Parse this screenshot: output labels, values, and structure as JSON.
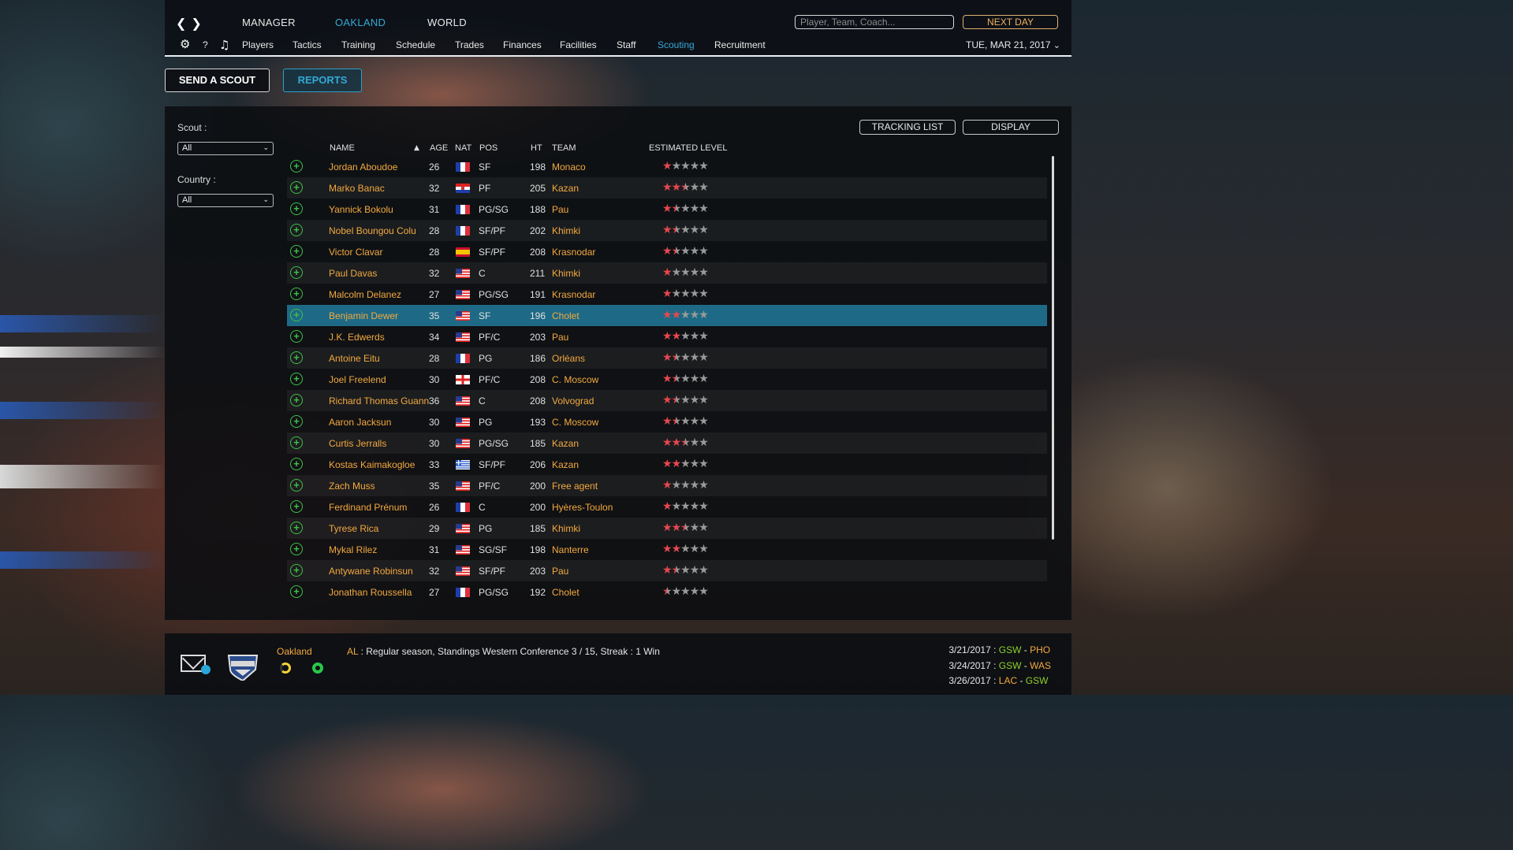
{
  "nav": {
    "tabs": [
      {
        "label": "MANAGER"
      },
      {
        "label": "OAKLAND"
      },
      {
        "label": "WORLD"
      }
    ],
    "search_placeholder": "Player, Team, Coach...",
    "next_day": "NEXT DAY",
    "sub_items": [
      "Players",
      "Tactics",
      "Training",
      "Schedule",
      "Trades",
      "Finances",
      "Facilities",
      "Staff",
      "Scouting",
      "Recruitment"
    ],
    "help": "?",
    "date": "TUE, MAR 21, 2017"
  },
  "actions": {
    "send_scout": "SEND A SCOUT",
    "reports": "REPORTS"
  },
  "filters": {
    "scout_label": "Scout :",
    "scout_value": "All",
    "country_label": "Country :",
    "country_value": "All"
  },
  "panel_buttons": {
    "tracking": "TRACKING LIST",
    "display": "DISPLAY"
  },
  "columns": {
    "name": "NAME",
    "age": "AGE",
    "nat": "NAT",
    "pos": "POS",
    "ht": "HT",
    "team": "TEAM",
    "level": "ESTIMATED LEVEL"
  },
  "players": [
    {
      "name": "Jordan Aboudoe",
      "age": "26",
      "nat": "FR",
      "pos": "SF",
      "ht": "198",
      "team": "Monaco",
      "stars": 1.0
    },
    {
      "name": "Marko Banac",
      "age": "32",
      "nat": "HR",
      "pos": "PF",
      "ht": "205",
      "team": "Kazan",
      "stars": 2.5
    },
    {
      "name": "Yannick Bokolu",
      "age": "31",
      "nat": "FR",
      "pos": "PG/SG",
      "ht": "188",
      "team": "Pau",
      "stars": 1.5
    },
    {
      "name": "Nobel Boungou Colu",
      "age": "28",
      "nat": "FR",
      "pos": "SF/PF",
      "ht": "202",
      "team": "Khimki",
      "stars": 1.5
    },
    {
      "name": "Victor Clavar",
      "age": "28",
      "nat": "ES",
      "pos": "SF/PF",
      "ht": "208",
      "team": "Krasnodar",
      "stars": 1.5
    },
    {
      "name": "Paul Davas",
      "age": "32",
      "nat": "US",
      "pos": "C",
      "ht": "211",
      "team": "Khimki",
      "stars": 1.0
    },
    {
      "name": "Malcolm Delanez",
      "age": "27",
      "nat": "US",
      "pos": "PG/SG",
      "ht": "191",
      "team": "Krasnodar",
      "stars": 1.0
    },
    {
      "name": "Benjamin Dewer",
      "age": "35",
      "nat": "US",
      "pos": "SF",
      "ht": "196",
      "team": "Cholet",
      "stars": 2.0
    },
    {
      "name": "J.K. Edwerds",
      "age": "34",
      "nat": "US",
      "pos": "PF/C",
      "ht": "203",
      "team": "Pau",
      "stars": 2.0
    },
    {
      "name": "Antoine Eitu",
      "age": "28",
      "nat": "FR",
      "pos": "PG",
      "ht": "186",
      "team": "Orléans",
      "stars": 1.5
    },
    {
      "name": "Joel Freelend",
      "age": "30",
      "nat": "EN",
      "pos": "PF/C",
      "ht": "208",
      "team": "C. Moscow",
      "stars": 1.5
    },
    {
      "name": "Richard Thomas Guann",
      "age": "36",
      "nat": "US",
      "pos": "C",
      "ht": "208",
      "team": "Volvograd",
      "stars": 1.5
    },
    {
      "name": "Aaron Jacksun",
      "age": "30",
      "nat": "US",
      "pos": "PG",
      "ht": "193",
      "team": "C. Moscow",
      "stars": 1.5
    },
    {
      "name": "Curtis Jerralls",
      "age": "30",
      "nat": "US",
      "pos": "PG/SG",
      "ht": "185",
      "team": "Kazan",
      "stars": 2.5
    },
    {
      "name": "Kostas Kaimakogloe",
      "age": "33",
      "nat": "GR",
      "pos": "SF/PF",
      "ht": "206",
      "team": "Kazan",
      "stars": 2.0
    },
    {
      "name": "Zach Muss",
      "age": "35",
      "nat": "US",
      "pos": "PF/C",
      "ht": "200",
      "team": "Free agent",
      "stars": 1.0
    },
    {
      "name": "Ferdinand Prénum",
      "age": "26",
      "nat": "FR",
      "pos": "C",
      "ht": "200",
      "team": "Hyères-Toulon",
      "stars": 1.0
    },
    {
      "name": "Tyrese Rica",
      "age": "29",
      "nat": "US",
      "pos": "PG",
      "ht": "185",
      "team": "Khimki",
      "stars": 2.5
    },
    {
      "name": "Mykal Rilez",
      "age": "31",
      "nat": "US",
      "pos": "SG/SF",
      "ht": "198",
      "team": "Nanterre",
      "stars": 2.0
    },
    {
      "name": "Antywane Robinsun",
      "age": "32",
      "nat": "US",
      "pos": "SF/PF",
      "ht": "203",
      "team": "Pau",
      "stars": 1.5
    },
    {
      "name": "Jonathan Roussella",
      "age": "27",
      "nat": "FR",
      "pos": "PG/SG",
      "ht": "192",
      "team": "Cholet",
      "stars": 0.5
    }
  ],
  "footer": {
    "team": "Oakland",
    "news_source": "AL",
    "news_text": " : Regular season, Standings Western Conference 3 / 15, Streak : 1 Win",
    "games": [
      {
        "date": "3/21/2017 : ",
        "home": "GSW",
        "away": "PHO"
      },
      {
        "date": "3/24/2017 : ",
        "home": "GSW",
        "away": "WAS"
      },
      {
        "date": "3/26/2017 : ",
        "home": "LAC",
        "away": "GSW"
      }
    ]
  },
  "colors": {
    "accent": "#34a8d6",
    "name": "#f3a93f",
    "star_on": "#e8474f",
    "star_off": "#9a9a9a",
    "selected_row": "#1e6a86",
    "add": "#3fbf4a"
  }
}
